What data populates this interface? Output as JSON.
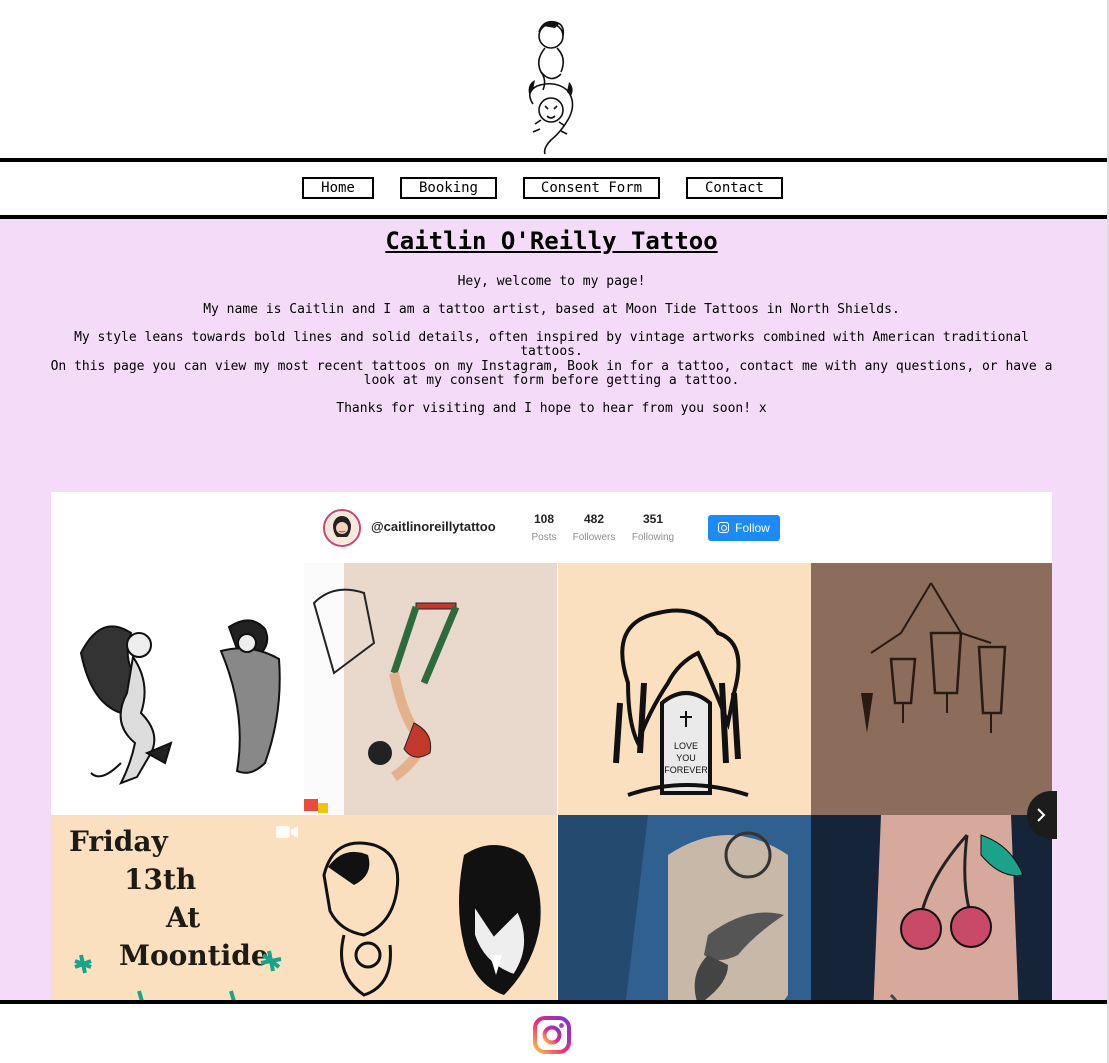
{
  "nav": {
    "items": [
      {
        "label": "Home"
      },
      {
        "label": "Booking"
      },
      {
        "label": "Consent Form"
      },
      {
        "label": "Contact"
      }
    ]
  },
  "main": {
    "title": "Caitlin O'Reilly Tattoo",
    "paragraphs": [
      "Hey, welcome to my page!",
      "My name is Caitlin and I am a tattoo artist, based at Moon Tide Tattoos in North Shields.",
      "My style leans towards bold lines and solid details, often inspired by vintage artworks combined with American traditional tattoos.",
      "On this page you can view my most recent tattoos on my Instagram, Book in for a tattoo, contact me with any questions, or have a look at my consent form before getting a tattoo.",
      "Thanks for visiting and I hope to hear from you soon! x"
    ]
  },
  "instagram": {
    "handle": "@caitlinoreillytattoo",
    "stats": [
      {
        "value": "108",
        "label": "Posts"
      },
      {
        "value": "482",
        "label": "Followers"
      },
      {
        "value": "351",
        "label": "Following"
      }
    ],
    "follow_label": "Follow",
    "accent_color": "#1c8bf5",
    "posts": [
      {
        "icon": "devil-pinup-flash"
      },
      {
        "icon": "trapeze-artist-tattoo"
      },
      {
        "icon": "willow-gravestone-flash"
      },
      {
        "icon": "lanterns-tattoo"
      },
      {
        "icon": "video-icon",
        "lines": [
          "Friday",
          "13th",
          "At",
          "Moontide"
        ]
      },
      {
        "icon": "woman-and-panther-flash"
      },
      {
        "icon": "swallow-tattoo"
      },
      {
        "icon": "cherries-tattoo"
      }
    ]
  },
  "footer": {
    "icon": "instagram-icon"
  },
  "colors": {
    "page_background": "#f4dcf8",
    "border": "#000000"
  }
}
